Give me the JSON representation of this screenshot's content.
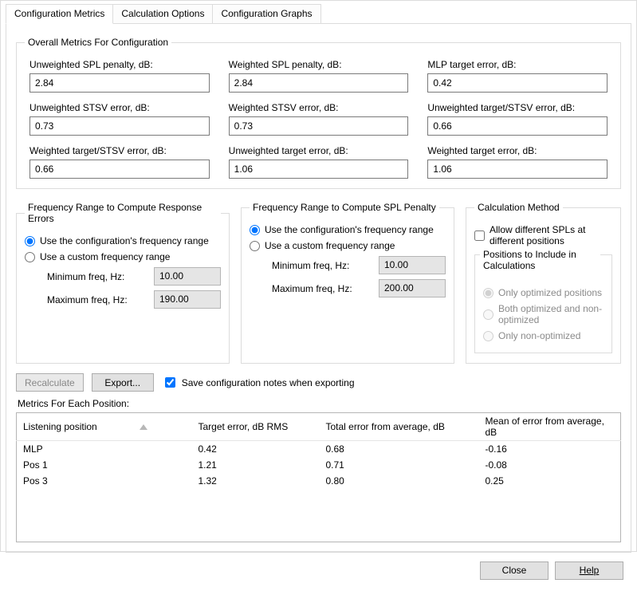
{
  "tabs": {
    "config_metrics": "Configuration Metrics",
    "calc_options": "Calculation Options",
    "config_graphs": "Configuration Graphs"
  },
  "overall": {
    "legend": "Overall Metrics For Configuration",
    "items": [
      {
        "label": "Unweighted SPL penalty, dB:",
        "value": "2.84"
      },
      {
        "label": "Weighted SPL penalty, dB:",
        "value": "2.84"
      },
      {
        "label": "MLP target error, dB:",
        "value": "0.42"
      },
      {
        "label": "Unweighted STSV error, dB:",
        "value": "0.73"
      },
      {
        "label": "Weighted STSV error, dB:",
        "value": "0.73"
      },
      {
        "label": "Unweighted target/STSV error, dB:",
        "value": "0.66"
      },
      {
        "label": "Weighted target/STSV error, dB:",
        "value": "0.66"
      },
      {
        "label": "Unweighted target error, dB:",
        "value": "1.06"
      },
      {
        "label": "Weighted target error, dB:",
        "value": "1.06"
      }
    ]
  },
  "freq_err": {
    "legend": "Frequency Range to Compute Response Errors",
    "opt_config": "Use the configuration's frequency range",
    "opt_custom": "Use a custom frequency range",
    "min_label": "Minimum freq, Hz:",
    "max_label": "Maximum freq, Hz:",
    "min_val": "10.00",
    "max_val": "190.00"
  },
  "freq_spl": {
    "legend": "Frequency Range to Compute SPL Penalty",
    "opt_config": "Use the configuration's frequency range",
    "opt_custom": "Use a custom frequency range",
    "min_label": "Minimum freq, Hz:",
    "max_label": "Maximum freq, Hz:",
    "min_val": "10.00",
    "max_val": "200.00"
  },
  "calc_method": {
    "legend": "Calculation Method",
    "allow_diff": "Allow different SPLs at different positions",
    "positions_legend": "Positions to Include in Calculations",
    "opt_only_opt": "Only optimized positions",
    "opt_both": "Both optimized and non-optimized",
    "opt_only_non": "Only non-optimized"
  },
  "actions": {
    "recalculate": "Recalculate",
    "export": "Export...",
    "save_notes": "Save configuration notes when exporting"
  },
  "positions": {
    "section_label": "Metrics For Each Position:",
    "headers": {
      "position": "Listening position",
      "target_err": "Target error, dB RMS",
      "total_err": "Total error from average, dB",
      "mean_err": "Mean of error from average, dB"
    },
    "rows": [
      {
        "position": "MLP",
        "target_err": "0.42",
        "total_err": "0.68",
        "mean_err": "-0.16"
      },
      {
        "position": "Pos 1",
        "target_err": "1.21",
        "total_err": "0.71",
        "mean_err": "-0.08"
      },
      {
        "position": "Pos 3",
        "target_err": "1.32",
        "total_err": "0.80",
        "mean_err": "0.25"
      }
    ]
  },
  "footer": {
    "close": "Close",
    "help": "Help"
  }
}
